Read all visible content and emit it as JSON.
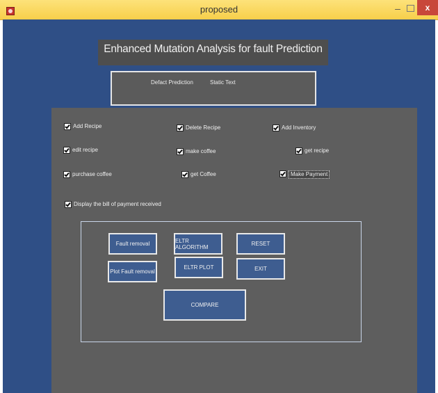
{
  "window": {
    "title": "proposed",
    "close_label": "x"
  },
  "header": {
    "title": "Enhanced Mutation Analysis for fault Prediction"
  },
  "info_box": {
    "label1": "Defact Prediction",
    "label2": "Static Text"
  },
  "checkboxes": [
    {
      "label": "Add Recipe",
      "checked": true
    },
    {
      "label": "Delete Recipe",
      "checked": true
    },
    {
      "label": "Add Inventory",
      "checked": true
    },
    {
      "label": "edit recipe",
      "checked": true
    },
    {
      "label": "make coffee",
      "checked": true
    },
    {
      "label": "get recipe",
      "checked": true
    },
    {
      "label": "purchase coffee",
      "checked": true
    },
    {
      "label": "get Coffee",
      "checked": true
    },
    {
      "label": "Make Payment",
      "checked": true
    },
    {
      "label": "Display the bill of payment received",
      "checked": true
    }
  ],
  "buttons": {
    "fault_removal": "Fault removal",
    "eltr_algorithm": "ELTR ALGORITHM",
    "reset": "RESET",
    "plot_fault_removal": "Plot Fault removal",
    "eltr_plot": "ELTR PLOT",
    "exit": "EXIT",
    "compare": "COMPARE"
  }
}
